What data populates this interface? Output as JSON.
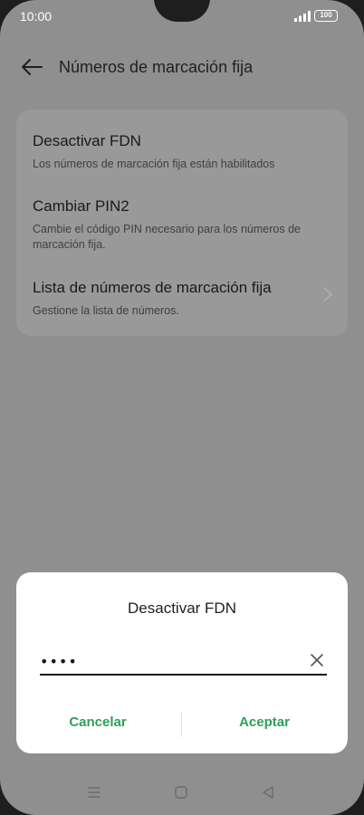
{
  "status_bar": {
    "time": "10:00",
    "battery": "100",
    "icons": [
      "signal-icon",
      "battery-icon"
    ]
  },
  "header": {
    "title": "Números de marcación fija",
    "back_icon": "back-arrow-icon"
  },
  "settings": {
    "items": [
      {
        "title": "Desactivar FDN",
        "subtitle": "Los números de marcación fija están habilitados"
      },
      {
        "title": "Cambiar PIN2",
        "subtitle": "Cambie el código PIN necesario para los números de marcación fija."
      },
      {
        "title": "Lista de números de marcación fija",
        "subtitle": "Gestione la lista de números."
      }
    ]
  },
  "dialog": {
    "title": "Desactivar FDN",
    "input_value": "1234",
    "cancel_label": "Cancelar",
    "accept_label": "Aceptar",
    "accent_color": "#2f9e5a"
  },
  "nav_bar": {
    "icons": [
      "menu-icon",
      "home-icon",
      "back-icon"
    ]
  }
}
